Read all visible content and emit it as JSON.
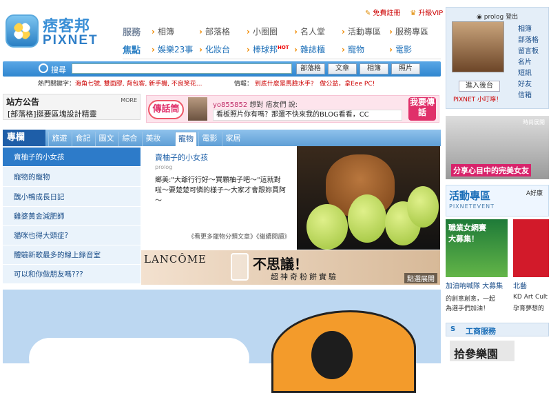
{
  "logo": {
    "cn": "痞客邦",
    "en": "PIXNET"
  },
  "toplinks": {
    "register": "免費註冊",
    "vip": "升級VIP"
  },
  "nav": {
    "row1_head": "服務",
    "row1": [
      "相簿",
      "部落格",
      "小圈圈",
      "名人堂",
      "活動專區",
      "服務專區"
    ],
    "row2_head": "焦點",
    "row2": [
      "娛樂23事",
      "化妝台",
      "棒球邦",
      "雜誌櫃",
      "寵物",
      "電影"
    ],
    "hot": "HOT"
  },
  "search": {
    "label": "搜尋",
    "buttons": [
      "部落格",
      "文章",
      "相簿",
      "照片"
    ]
  },
  "hotkw": {
    "label": "熱門關鍵字：",
    "value": "海角七號, 雙面膠, 背包客, 新手機, 不良笑花..."
  },
  "info": {
    "label": "情報：",
    "items": [
      "到底什麼是馬臉水手?",
      "做公益，拿Eee PC!"
    ]
  },
  "notice": {
    "title": "站方公告",
    "more": "MORE",
    "line": "[部落格]挺要區塊設計精靈"
  },
  "chuan": {
    "tag": "傳話筒",
    "user": "yo855852",
    "who_rest": "想對 痞友們 說:",
    "msg": "看板照片你有嗎？那還不快來我的BLOG看看，CC",
    "say": "我要傳話"
  },
  "columns": {
    "head": "專欄",
    "tabs": [
      "旅遊",
      "食記",
      "圖文",
      "綜合",
      "美妝",
      "寵物",
      "電影",
      "家居"
    ]
  },
  "list": [
    "賣柚子的小女孩",
    "寵物的寵物",
    "醜小鴨成長日記",
    "雞婆黃金減肥師",
    "貓咪也得大頭症?",
    "體驗新歌最多的線上錄音室",
    "可以和你做朋友嗎???"
  ],
  "content": {
    "title": "賣柚子的小女孩",
    "author": "prolog",
    "text": "鄉美:\"大爺行行好～買顆柚子吧～\"這就對啦～要楚楚可憐的樣子～大家才會跟妳買阿～",
    "more": "《看更多寵物分類文章》《繼續閱讀》"
  },
  "lancome": {
    "brand": "LANCÔME",
    "big": "不思議！",
    "sub": "超神奇粉餅實驗",
    "expand": "點選展開"
  },
  "login": {
    "user": "prolog",
    "logout": "登出",
    "enter": "進入後台",
    "tip": "PIXNET 小叮嚀！",
    "links": [
      "相簿",
      "部落格",
      "留言板",
      "名片",
      "短訊",
      "好友",
      "信箱"
    ]
  },
  "ad1": {
    "caption": "分享心目中的完美女友",
    "tag": "時尚展開"
  },
  "event": {
    "title": "活動專區",
    "sub": "PIXNETEVENT",
    "good": "A好康"
  },
  "ads2": {
    "a_title": "職業女網賽",
    "a_sub": "大募集！",
    "l1": "加油吶喊隊 大募集",
    "l2": "北藝",
    "l3": "的創意創意，一起",
    "l4": "KD Art Cult",
    "l5": "孕育夢想的",
    "l6": "為選手們加油！"
  },
  "biz": {
    "s": "S",
    "title": "工商服務"
  },
  "joy": "拾參樂園"
}
